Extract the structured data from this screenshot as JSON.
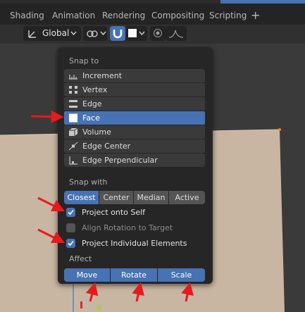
{
  "tabs": [
    "Shading",
    "Animation",
    "Rendering",
    "Compositing",
    "Scripting",
    "+"
  ],
  "header": {
    "orientation_label": "Global",
    "orientation_icon": "transform-orientation-icon",
    "pivot_icon": "pivot-icon",
    "snap_toggle_icon": "magnet-snap-icon",
    "snap_target_icon": "face-snap-icon",
    "proportional_icon": "proportional-edit-icon",
    "falloff_icon": "falloff-curve-icon"
  },
  "popup": {
    "snap_to_label": "Snap to",
    "snap_targets": [
      {
        "label": "Increment",
        "icon": "increment-icon",
        "selected": false
      },
      {
        "label": "Vertex",
        "icon": "vertex-icon",
        "selected": false
      },
      {
        "label": "Edge",
        "icon": "edge-icon",
        "selected": false
      },
      {
        "label": "Face",
        "icon": "face-icon",
        "selected": true
      },
      {
        "label": "Volume",
        "icon": "volume-icon",
        "selected": false
      },
      {
        "label": "Edge Center",
        "icon": "edge-center-icon",
        "selected": false
      },
      {
        "label": "Edge Perpendicular",
        "icon": "edge-perpendicular-icon",
        "selected": false
      }
    ],
    "snap_with_label": "Snap with",
    "snap_with": [
      {
        "label": "Closest",
        "selected": true
      },
      {
        "label": "Center",
        "selected": false
      },
      {
        "label": "Median",
        "selected": false
      },
      {
        "label": "Active",
        "selected": false
      }
    ],
    "options": [
      {
        "label": "Project onto Self",
        "checked": true
      },
      {
        "label": "Align Rotation to Target",
        "checked": false
      },
      {
        "label": "Project Individual Elements",
        "checked": true
      }
    ],
    "affect_label": "Affect",
    "affect": [
      {
        "label": "Move",
        "selected": true
      },
      {
        "label": "Rotate",
        "selected": true
      },
      {
        "label": "Scale",
        "selected": true
      }
    ]
  },
  "colors": {
    "accent": "#4772b3",
    "annotation_arrow": "#e8191c",
    "plane": "#c8b6a2"
  }
}
